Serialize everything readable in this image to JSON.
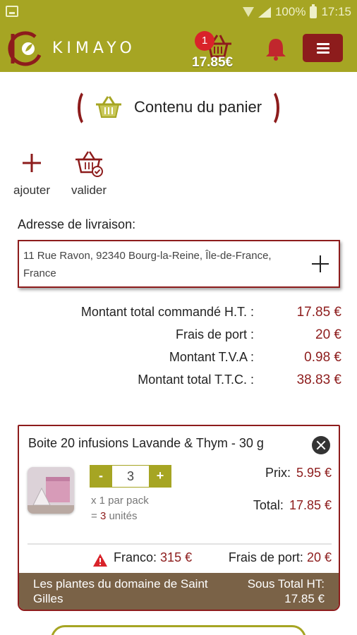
{
  "status_bar": {
    "battery_percent": "100%",
    "time": "17:15"
  },
  "header": {
    "brand": "KIMAYO",
    "cart_count": "1",
    "cart_total": "17.85€"
  },
  "page": {
    "title": "Contenu du panier"
  },
  "actions": [
    {
      "label": "ajouter",
      "icon": "plus-icon"
    },
    {
      "label": "valider",
      "icon": "basket-check-icon"
    }
  ],
  "address": {
    "label": "Adresse de livraison:",
    "value": "11 Rue Ravon, 92340 Bourg-la-Reine, Île-de-France, France"
  },
  "totals": [
    {
      "label": "Montant total commandé H.T. :",
      "value": "17.85 €"
    },
    {
      "label": "Frais de port :",
      "value": "20 €"
    },
    {
      "label": "Montant T.V.A :",
      "value": "0.98 €"
    },
    {
      "label": "Montant total T.T.C. :",
      "value": "38.83 €"
    }
  ],
  "product": {
    "title": "Boite 20 infusions Lavande & Thym - 30 g",
    "qty_minus": "-",
    "quantity": "3",
    "qty_plus": "+",
    "per_pack": "x 1 par pack",
    "units_prefix": "= ",
    "units_count": "3",
    "units_suffix": " unités",
    "price_label": "Prix:",
    "price_value": "5.95 €",
    "total_label": "Total:",
    "total_value": "17.85 €",
    "franco_label": "Franco:",
    "franco_value": "315 €",
    "shipping_label": "Frais de port:",
    "shipping_value": "20 €",
    "seller": "Les plantes du domaine de Saint Gilles",
    "subtotal_label": "Sous Total HT:",
    "subtotal_value": "17.85 €"
  },
  "colors": {
    "olive": "#a6a523",
    "burgundy": "#8d1c1c",
    "brown_footer": "#7a6247",
    "badge_red": "#d9232a"
  }
}
